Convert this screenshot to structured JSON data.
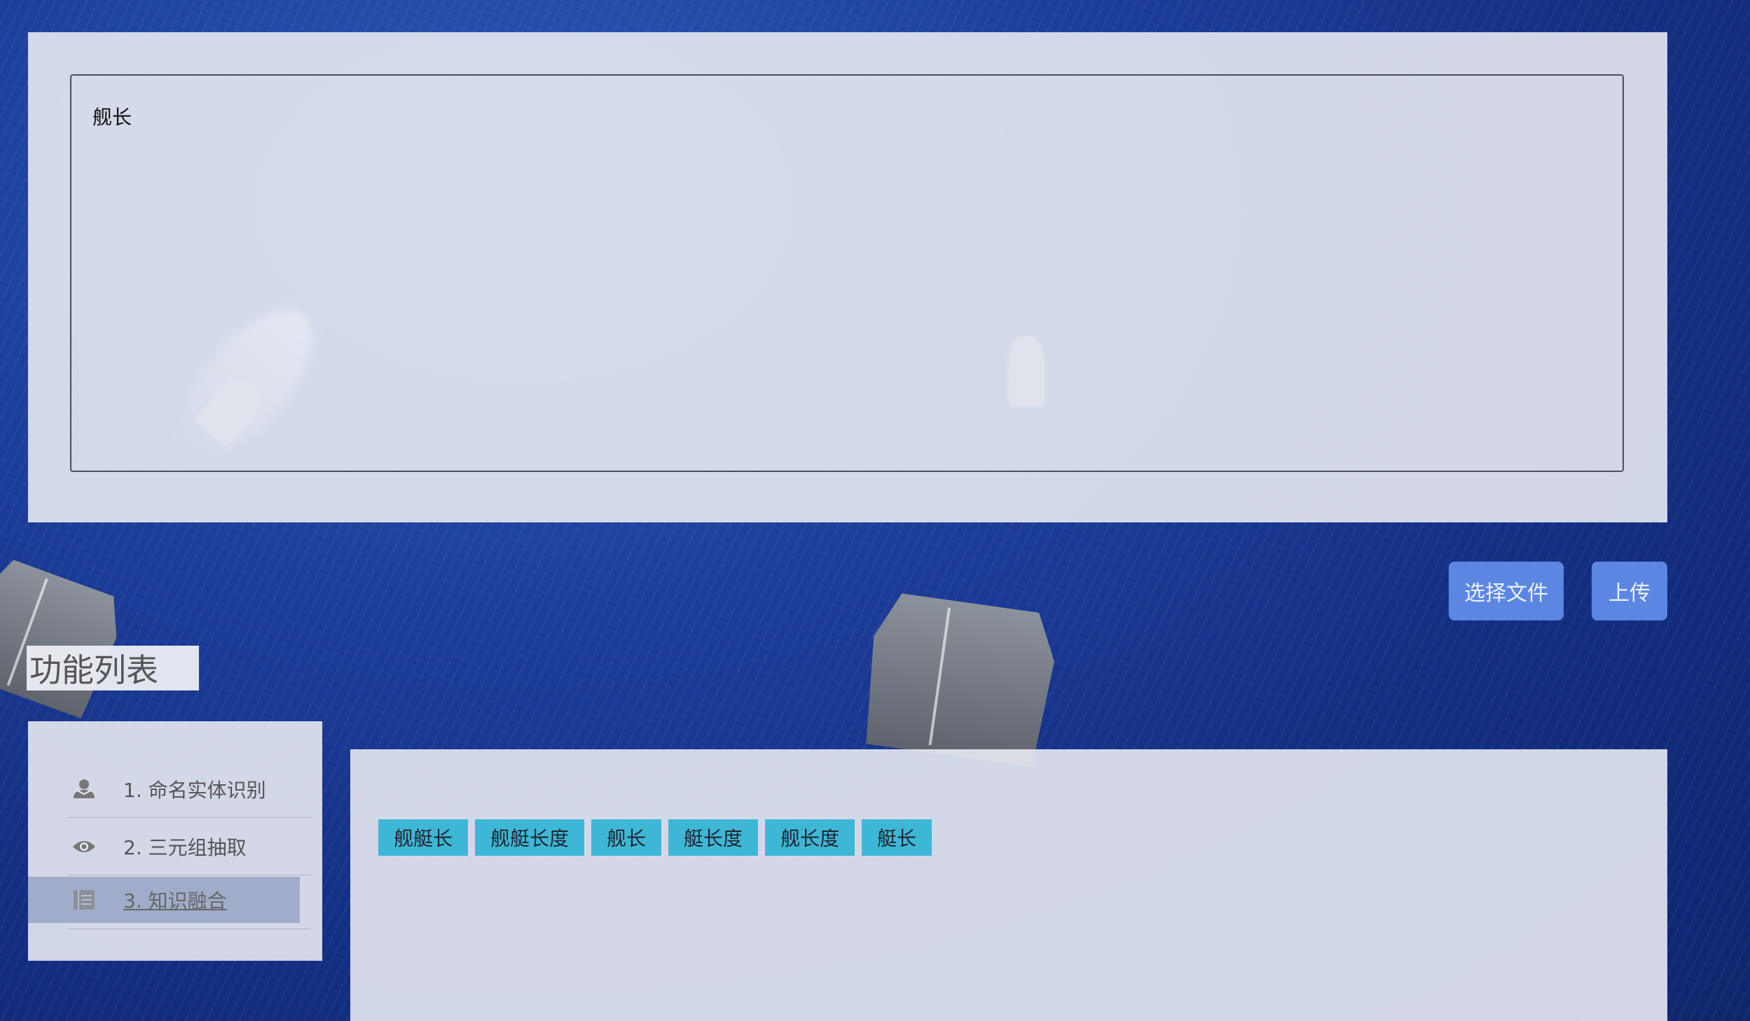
{
  "editor": {
    "text": "舰长"
  },
  "actions": {
    "choose_file_label": "选择文件",
    "upload_label": "上传"
  },
  "function_list": {
    "title": "功能列表",
    "items": [
      {
        "label": "1. 命名实体识别",
        "icon": "user-icon"
      },
      {
        "label": "2. 三元组抽取",
        "icon": "eye-icon"
      },
      {
        "label": "3. 知识融合",
        "icon": "book-icon",
        "active": true
      }
    ]
  },
  "results": {
    "tags": [
      "舰艇长",
      "舰艇长度",
      "舰长",
      "艇长度",
      "舰长度",
      "艇长"
    ]
  },
  "colors": {
    "accent_button": "#5b87e3",
    "tag_bg": "#3eb7d6",
    "active_menu_bg": "#96a5c3"
  }
}
